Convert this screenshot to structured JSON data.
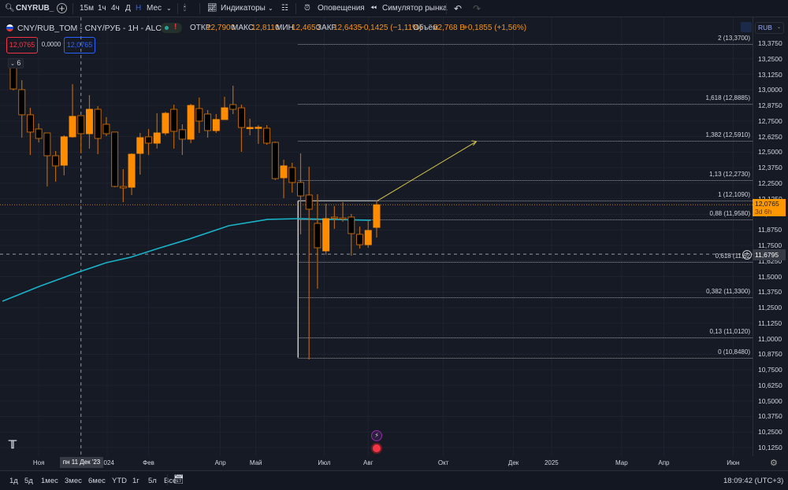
{
  "toolbar": {
    "symbol": "CNYRUB_",
    "intervals": [
      "15м",
      "1ч",
      "4ч",
      "Д",
      "Н",
      "Мес"
    ],
    "active_interval": "Н",
    "indicators": "Индикаторы",
    "alerts": "Оповещения",
    "replay": "Симулятор рынка"
  },
  "legend": {
    "title": "CNY/RUB_TOM - CNY/РУБ - 1H - ALOR",
    "open_label": "ОТКР",
    "open": "12,7900",
    "high_label": "МАКС",
    "high": "12,8110",
    "low_label": "МИН",
    "low": "12,4650",
    "close_label": "ЗАКР",
    "close": "12,6435",
    "change": "−0,1425 (−1,11%)",
    "volume_label": "Объём",
    "volume": "52,768 B",
    "extra": "+0,1855 (+1,56%)",
    "sell": "12,0765",
    "spread": "0,0000",
    "buy": "12,0765",
    "collapse_count": "6"
  },
  "price_axis": {
    "currency": "RUB",
    "current_price": "12,0765",
    "countdown": "3d 6h",
    "crosshair_price": "11,6795"
  },
  "time_axis": {
    "crosshair_label": "пн 11 Дек '23"
  },
  "range_buttons": [
    "1д",
    "5д",
    "1мес",
    "3мес",
    "6мес",
    "YTD",
    "1г",
    "5л",
    "Все"
  ],
  "clock": "18:09:42 (UTC+3)",
  "colors": {
    "up": "#ff8c00",
    "down_border": "#b8650f",
    "ma": "#19b3c9",
    "bg": "#161a25",
    "accent": "#2962ff"
  },
  "chart_data": {
    "type": "candlestick",
    "ylim": [
      10.1,
      13.45
    ],
    "y_ticks": [
      "13,3750",
      "13,2500",
      "13,1250",
      "13,0000",
      "12,8750",
      "12,7500",
      "12,6250",
      "12,5000",
      "12,3750",
      "12,2500",
      "12,1250",
      "12,0000",
      "11,8750",
      "11,7500",
      "11,6250",
      "11,5000",
      "11,3750",
      "11,2500",
      "11,1250",
      "11,0000",
      "10,8750",
      "10,7500",
      "10,6250",
      "10,5000",
      "10,3750",
      "10,2500",
      "10,1250"
    ],
    "x_ticks": [
      {
        "label": "Ноя",
        "bar": 3.0
      },
      {
        "label": "2024",
        "bar": 11.1
      },
      {
        "label": "Фев",
        "bar": 16
      },
      {
        "label": "Апр",
        "bar": 24.5
      },
      {
        "label": "Май",
        "bar": 28.7
      },
      {
        "label": "Июл",
        "bar": 36.8
      },
      {
        "label": "Авг",
        "bar": 42
      },
      {
        "label": "Окт",
        "bar": 50.9
      },
      {
        "label": "Дек",
        "bar": 59.2
      },
      {
        "label": "2025",
        "bar": 63.7
      },
      {
        "label": "Мар",
        "bar": 72
      },
      {
        "label": "Апр",
        "bar": 77
      },
      {
        "label": "Июн",
        "bar": 85.2
      }
    ],
    "crosshair": {
      "bar": 8,
      "price": 11.6795
    },
    "ohlc": [
      [
        13.185,
        13.249,
        12.996,
        13.008
      ],
      [
        13.002,
        13.078,
        12.616,
        12.8
      ],
      [
        12.8,
        12.856,
        12.477,
        12.661
      ],
      [
        12.686,
        12.73,
        12.578,
        12.61
      ],
      [
        12.654,
        12.654,
        12.224,
        12.471
      ],
      [
        12.471,
        12.509,
        12.262,
        12.389
      ],
      [
        12.395,
        12.635,
        12.313,
        12.623
      ],
      [
        12.623,
        13.046,
        12.616,
        12.787
      ],
      [
        12.793,
        12.793,
        12.49,
        12.648
      ],
      [
        12.648,
        12.958,
        12.528,
        12.844
      ],
      [
        12.844,
        12.869,
        12.483,
        12.61
      ],
      [
        12.724,
        12.781,
        12.629,
        12.648
      ],
      [
        12.661,
        12.661,
        12.218,
        12.224
      ],
      [
        12.224,
        12.363,
        12.098,
        12.212
      ],
      [
        12.218,
        12.49,
        12.155,
        12.483
      ],
      [
        12.49,
        12.654,
        12.319,
        12.616
      ],
      [
        12.623,
        12.686,
        12.477,
        12.572
      ],
      [
        12.572,
        12.812,
        12.528,
        12.654
      ],
      [
        12.654,
        12.824,
        12.636,
        12.812
      ],
      [
        12.844,
        12.882,
        12.528,
        12.667
      ],
      [
        12.68,
        12.724,
        12.477,
        12.604
      ],
      [
        12.604,
        12.888,
        12.572,
        12.875
      ],
      [
        12.85,
        12.939,
        12.654,
        12.749
      ],
      [
        12.806,
        12.838,
        12.616,
        12.673
      ],
      [
        12.673,
        12.806,
        12.654,
        12.762
      ],
      [
        12.762,
        12.945,
        12.762,
        12.856
      ],
      [
        12.882,
        13.034,
        12.806,
        12.844
      ],
      [
        12.856,
        12.882,
        12.502,
        12.698
      ],
      [
        12.698,
        12.768,
        12.635,
        12.698
      ],
      [
        12.698,
        12.717,
        12.566,
        12.7
      ],
      [
        12.692,
        12.717,
        12.559,
        12.572
      ],
      [
        12.578,
        12.585,
        12.275,
        12.287
      ],
      [
        12.294,
        12.439,
        12.129,
        12.389
      ],
      [
        12.376,
        12.414,
        12.174,
        12.256
      ],
      [
        12.256,
        12.49,
        11.839,
        12.148
      ],
      [
        12.155,
        12.382,
        10.833,
        12.041
      ],
      [
        11.927,
        12.161,
        11.402,
        11.731
      ],
      [
        11.706,
        12.085,
        11.674,
        11.965
      ],
      [
        11.978,
        12.066,
        11.883,
        11.971
      ],
      [
        11.971,
        12.098,
        11.94,
        11.965
      ],
      [
        11.978,
        12.003,
        11.668,
        11.845
      ],
      [
        11.839,
        11.902,
        11.725,
        11.756
      ],
      [
        11.756,
        11.946,
        11.731,
        11.87
      ],
      [
        11.895,
        12.11,
        11.813,
        12.0765
      ]
    ],
    "ma": [
      [
        -1.3,
        11.301
      ],
      [
        3.1,
        11.421
      ],
      [
        7.7,
        11.535
      ],
      [
        11,
        11.611
      ],
      [
        13.9,
        11.655
      ],
      [
        17.1,
        11.725
      ],
      [
        20.8,
        11.801
      ],
      [
        25.5,
        11.908
      ],
      [
        30.1,
        11.959
      ],
      [
        33.9,
        11.965
      ],
      [
        42.3,
        11.952
      ]
    ],
    "fib": {
      "start_bar": 33.7,
      "levels": [
        {
          "label": "2 (13,3700)",
          "price": 13.37
        },
        {
          "label": "1,618 (12,8885)",
          "price": 12.8885
        },
        {
          "label": "1,382 (12,5910)",
          "price": 12.591
        },
        {
          "label": "1,13 (12,2730)",
          "price": 12.273
        },
        {
          "label": "1 (12,1090)",
          "price": 12.109
        },
        {
          "label": "0,88 (11,9580)",
          "price": 11.958
        },
        {
          "label": "0,618 (11,62",
          "price": 11.62
        },
        {
          "label": "0,382 (11,3300)",
          "price": 11.33
        },
        {
          "label": "0,13 (11,0120)",
          "price": 11.012
        },
        {
          "label": "0 (10,8480)",
          "price": 10.848
        }
      ]
    },
    "projection": {
      "from": [
        43.1,
        12.109
      ],
      "to": [
        54.8,
        12.585
      ]
    }
  }
}
